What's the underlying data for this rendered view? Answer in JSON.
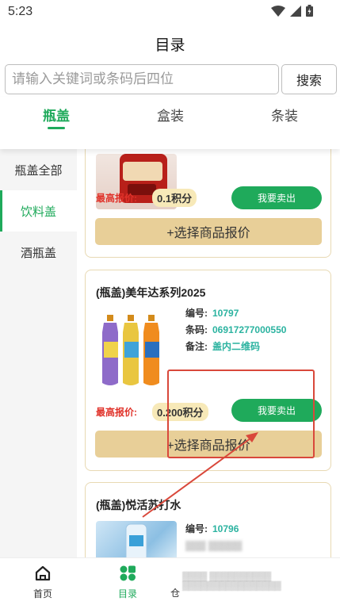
{
  "status": {
    "time": "5:23"
  },
  "header": {
    "title": "目录"
  },
  "search": {
    "placeholder": "请输入关键词或条码后四位",
    "button": "搜索"
  },
  "tabs": [
    {
      "label": "瓶盖",
      "active": true
    },
    {
      "label": "盒装",
      "active": false
    },
    {
      "label": "条装",
      "active": false
    }
  ],
  "sidebar": {
    "items": [
      {
        "label": "瓶盖全部",
        "active": false
      },
      {
        "label": "饮料盖",
        "active": true
      },
      {
        "label": "酒瓶盖",
        "active": false
      }
    ]
  },
  "products": [
    {
      "price_label": "最高报价:",
      "price": "0.1积分",
      "sell": "我要卖出",
      "quote": "+选择商品报价"
    },
    {
      "title": "(瓶盖)美年达系列2025",
      "fields": [
        {
          "k": "编号:",
          "v": "10797"
        },
        {
          "k": "条码:",
          "v": "06917277000550"
        },
        {
          "k": "备注:",
          "v": "盖内二维码"
        }
      ],
      "price_label": "最高报价:",
      "price": "0.200积分",
      "sell": "我要卖出",
      "quote": "+选择商品报价"
    },
    {
      "title": "(瓶盖)悦活苏打水",
      "fields": [
        {
          "k": "编号:",
          "v": "10796"
        }
      ]
    }
  ],
  "bottom_nav": [
    {
      "label": "首页",
      "icon": "home-icon",
      "active": false
    },
    {
      "label": "目录",
      "icon": "catalog-icon",
      "active": true
    },
    {
      "label": "仓",
      "icon": "",
      "active": false
    }
  ],
  "colors": {
    "accent": "#1faa5b",
    "price_red": "#e0322a",
    "quote_bg": "#e8cf98",
    "annotation": "#d9483b"
  }
}
